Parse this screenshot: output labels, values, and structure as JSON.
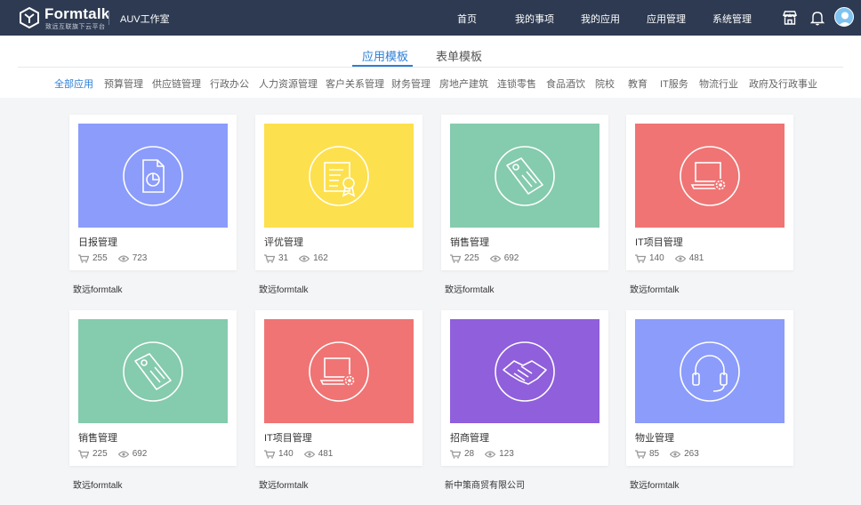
{
  "header": {
    "brand": "Formtalk",
    "brand_sub": "致远互联旗下云平台",
    "workspace": "AUV工作室",
    "nav": [
      "首页",
      "我的事项",
      "我的应用",
      "应用管理",
      "系统管理"
    ],
    "icons": [
      "store-icon",
      "bell-icon",
      "avatar"
    ]
  },
  "tabs": {
    "items": [
      "应用模板",
      "表单模板"
    ],
    "active": "应用模板"
  },
  "categories": [
    "全部应用",
    "预算管理",
    "供应链管理",
    "行政办公",
    "人力资源管理",
    "客户关系管理",
    "财务管理",
    "房地产建筑",
    "连锁零售",
    "食品酒饮",
    "院校",
    "教育",
    "IT服务",
    "物流行业",
    "政府及行政事业"
  ],
  "active_category": "全部应用",
  "cards": [
    {
      "title": "日报管理",
      "installs": "255",
      "views": "723",
      "author": "致远formtalk",
      "color": "#8b9cfb",
      "icon": "report-chart-icon"
    },
    {
      "title": "评优管理",
      "installs": "31",
      "views": "162",
      "author": "致远formtalk",
      "color": "#fde04d",
      "icon": "certificate-icon"
    },
    {
      "title": "销售管理",
      "installs": "225",
      "views": "692",
      "author": "致远formtalk",
      "color": "#85cbae",
      "icon": "price-tag-icon"
    },
    {
      "title": "IT项目管理",
      "installs": "140",
      "views": "481",
      "author": "致远formtalk",
      "color": "#f07474",
      "icon": "laptop-gear-icon"
    },
    {
      "title": "销售管理",
      "installs": "225",
      "views": "692",
      "author": "致远formtalk",
      "color": "#85cbae",
      "icon": "price-tag-icon"
    },
    {
      "title": "IT项目管理",
      "installs": "140",
      "views": "481",
      "author": "致远formtalk",
      "color": "#f07474",
      "icon": "laptop-gear-icon"
    },
    {
      "title": "招商管理",
      "installs": "28",
      "views": "123",
      "author": "新中策商贸有限公司",
      "color": "#8f5fdc",
      "icon": "handshake-icon"
    },
    {
      "title": "物业管理",
      "installs": "85",
      "views": "263",
      "author": "致远formtalk",
      "color": "#8b9cfb",
      "icon": "headset-icon"
    }
  ],
  "stat_icons": [
    "cart-icon",
    "eye-icon"
  ]
}
